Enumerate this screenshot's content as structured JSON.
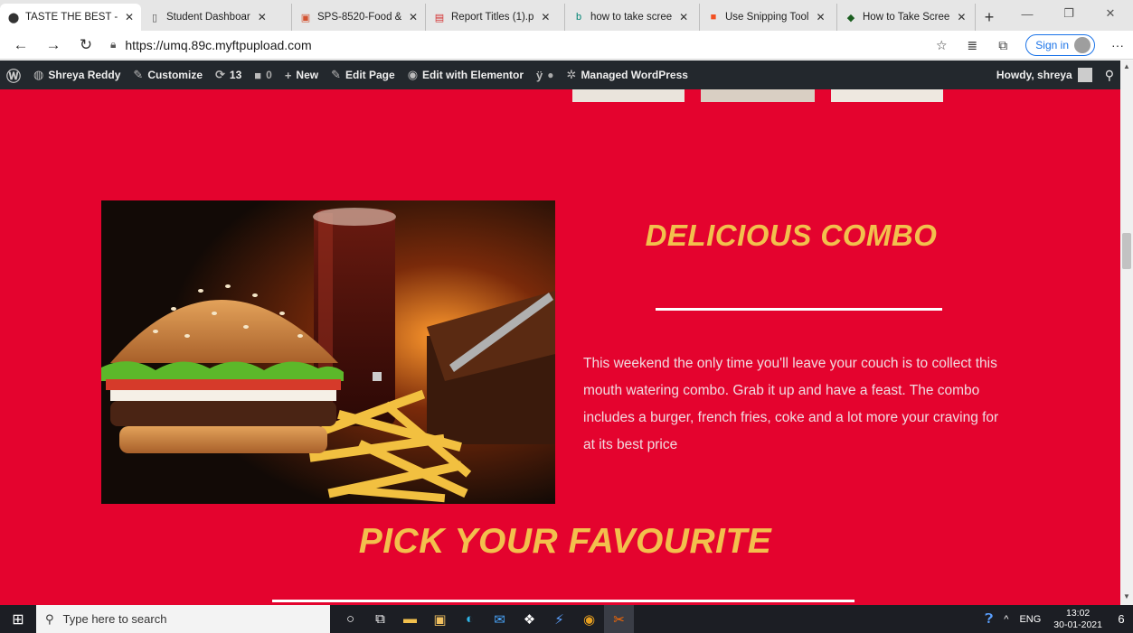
{
  "browser": {
    "tabs": [
      {
        "label": "TASTE THE BEST -",
        "icon": "map-pin-icon",
        "glyph": "⬤",
        "color": "#333333",
        "active": true
      },
      {
        "label": "Student Dashboar",
        "icon": "page-icon",
        "glyph": "▯",
        "color": "#555555",
        "active": false
      },
      {
        "label": "SPS-8520-Food &",
        "icon": "ppt-icon",
        "glyph": "▣",
        "color": "#d35230",
        "active": false
      },
      {
        "label": "Report Titles (1).p",
        "icon": "pdf-icon",
        "glyph": "▤",
        "color": "#d32f2f",
        "active": false
      },
      {
        "label": "how to take scree",
        "icon": "bing-icon",
        "glyph": "b",
        "color": "#008373",
        "active": false
      },
      {
        "label": "Use Snipping Tool",
        "icon": "microsoft-icon",
        "glyph": "■",
        "color": "#f25022",
        "active": false
      },
      {
        "label": "How to Take Scree",
        "icon": "website-icon",
        "glyph": "◆",
        "color": "#1b5e20",
        "active": false
      }
    ],
    "url": "https://umq.89c.myftpupload.com",
    "sign_in": "Sign in"
  },
  "wp_admin": {
    "site_name": "Shreya Reddy",
    "customize": "Customize",
    "updates": "13",
    "comments": "0",
    "new": "New",
    "edit_page": "Edit Page",
    "edit_elementor": "Edit with Elementor",
    "managed": "Managed WordPress",
    "howdy": "Howdy, shreya"
  },
  "content": {
    "combo_title": "DELICIOUS COMBO",
    "combo_text": "This weekend the only time you'll leave your couch is to collect this mouth watering combo. Grab it up and have a feast. The combo includes a burger, french fries, coke and a lot more your craving for at its best price",
    "pick_title": "PICK YOUR FAVOURITE"
  },
  "taskbar": {
    "search_placeholder": "Type here to search",
    "lang": "ENG",
    "time": "13:02",
    "date": "30-01-2021",
    "notifications": "6"
  },
  "colors": {
    "page_bg": "#e4032e",
    "heading": "#f2c04d",
    "wp_bar": "#23282d"
  }
}
